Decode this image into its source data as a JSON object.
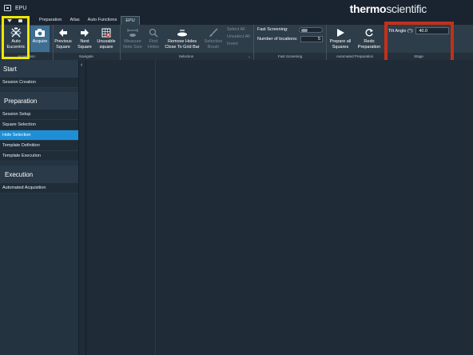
{
  "titlebar": {
    "title": "EPU",
    "brand_bold": "thermo",
    "brand_light": "scientific"
  },
  "tabs": [
    {
      "label": "Preparation",
      "active": false
    },
    {
      "label": "Atlas",
      "active": false
    },
    {
      "label": "Auto Functions",
      "active": false
    },
    {
      "label": "EPU",
      "active": true
    }
  ],
  "ribbon": {
    "auto_eucentric": {
      "line1": "Auto",
      "line2": "Eucentric"
    },
    "acquire": {
      "line1": "Acquire"
    },
    "previous_square": {
      "line1": "Previous",
      "line2": "Square"
    },
    "next_square": {
      "line1": "Next",
      "line2": "Square"
    },
    "unusable_square": {
      "line1": "Unusable",
      "line2": "square"
    },
    "measure_hole_size": {
      "line1": "Measure",
      "line2": "Hole Size"
    },
    "find_holes": {
      "line1": "Find",
      "line2": "Holes"
    },
    "remove_holes": {
      "line1": "Remove Holes",
      "line2": "Close To Grid Bar"
    },
    "selection_brush": {
      "line1": "Selection",
      "line2": "Brush"
    },
    "select_all": "Select All",
    "unselect_all": "Unselect All",
    "invert": "Invert",
    "fast_screening_label": "Fast Screening:",
    "number_of_locations_label": "Number of locations:",
    "number_of_locations_value": "5",
    "prepare_all_squares": {
      "line1": "Prepare all",
      "line2": "Squares"
    },
    "redo_preparation": {
      "line1": "Redo",
      "line2": "Preparation"
    },
    "tilt_angle_label": "Tilt Angle (°):",
    "tilt_angle_value": "40.0",
    "group_labels": {
      "acquisition": "Acquisition",
      "navigate": "Navigate",
      "selection": "Selection",
      "fast_screening": "Fast Screening",
      "automated_preparation": "Automated Preparation",
      "stage": "Stage"
    }
  },
  "sidebar": {
    "start": {
      "title": "Start",
      "items": [
        "Session Creation"
      ]
    },
    "preparation": {
      "title": "Preparation",
      "items": [
        "Session Setup",
        "Square Selection",
        "Hole Selection",
        "Template Definition",
        "Template Execution"
      ],
      "selected": "Hole Selection"
    },
    "execution": {
      "title": "Execution",
      "items": [
        "Automated Acquisition"
      ]
    }
  },
  "colors": {
    "accent": "#1e8fd6",
    "highlight_yellow": "#f2e600",
    "highlight_red": "#c0311c"
  }
}
